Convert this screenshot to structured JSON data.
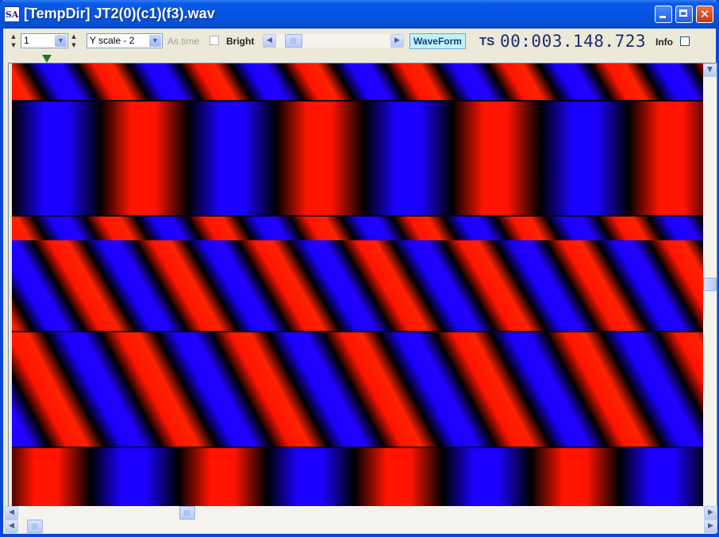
{
  "window": {
    "app_icon_text": "SA",
    "title": "[TempDir] JT2(0)(c1)(f3).wav"
  },
  "toolbar": {
    "channel_value": "1",
    "yscale_value": "Y scale - 2",
    "as_time_label": "As time",
    "bright_label": "Bright",
    "waveform_label": "WaveForm",
    "ts_label": "TS",
    "time_value": "00:003.148.723",
    "info_label": "Info"
  },
  "colors": {
    "red": "#ff1400",
    "blue": "#1a00ff",
    "title_bar": "#0654e0",
    "waveform_button": "#bff3fb"
  },
  "icons": {
    "minimize": "minimize-icon",
    "maximize": "maximize-icon",
    "close": "close-icon",
    "marker": "position-marker-icon"
  }
}
